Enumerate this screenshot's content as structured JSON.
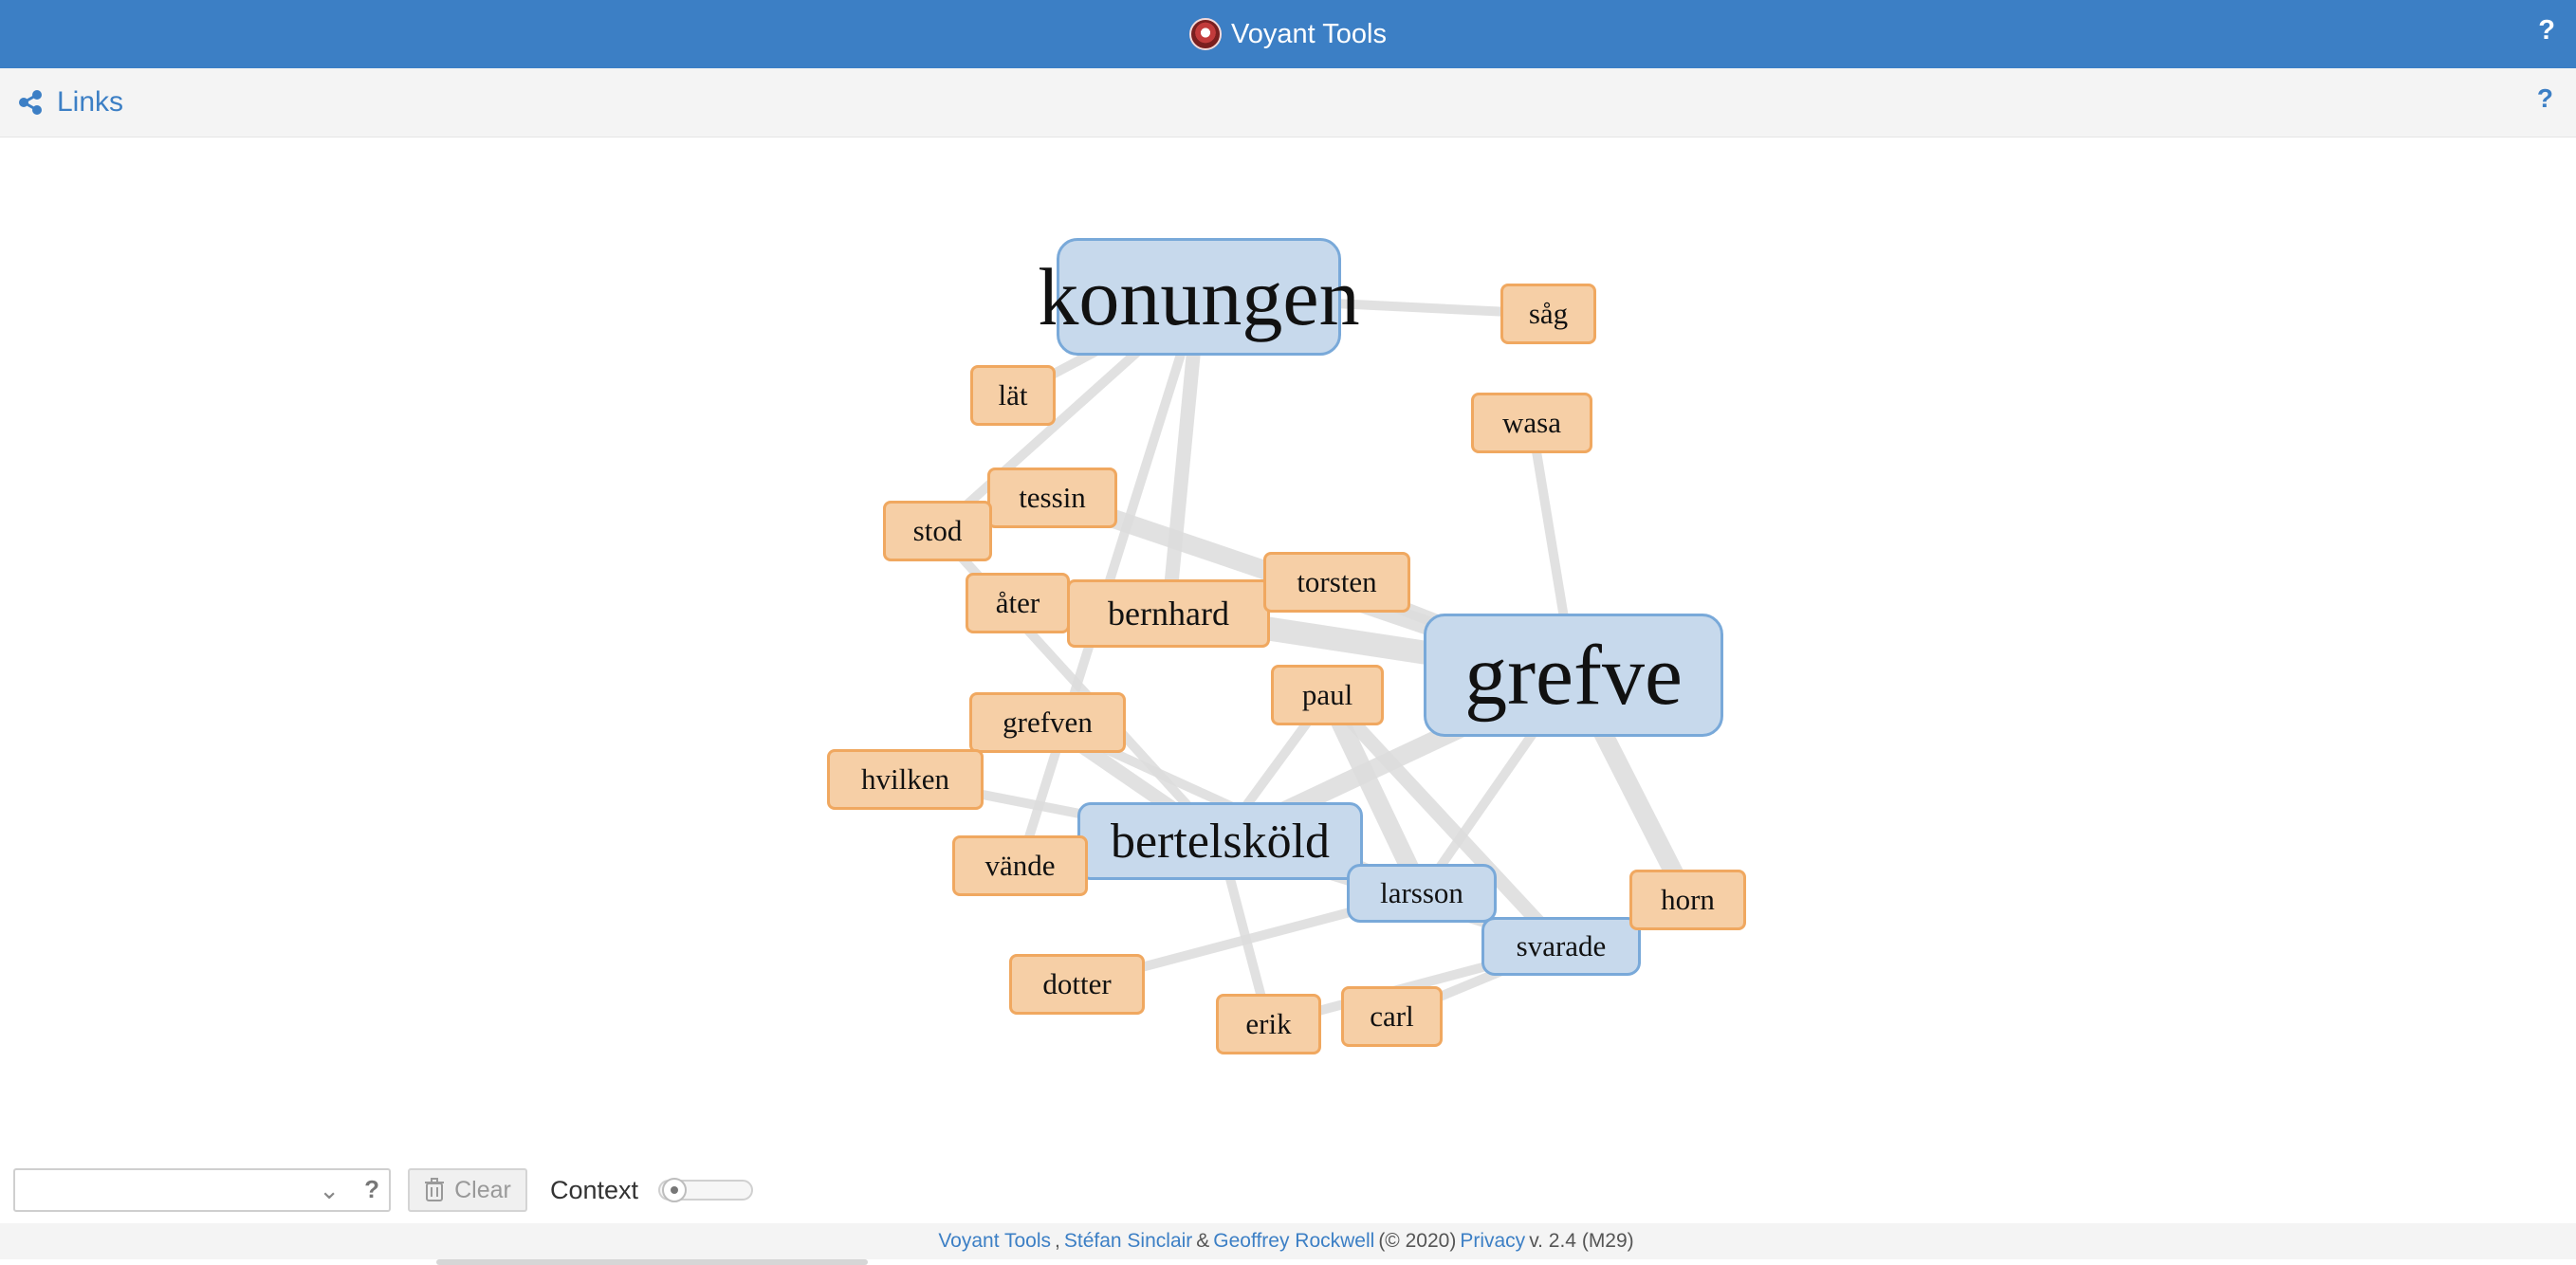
{
  "app": {
    "title": "Voyant Tools",
    "help_label": "?"
  },
  "panel": {
    "title": "Links",
    "help_label": "?"
  },
  "graph": {
    "nodes": [
      {
        "id": "konungen",
        "label": "konungen",
        "kind": "term",
        "weight": "large"
      },
      {
        "id": "grefve",
        "label": "grefve",
        "kind": "term",
        "weight": "large"
      },
      {
        "id": "bertelskold",
        "label": "bertelsköld",
        "kind": "term",
        "weight": "medium"
      },
      {
        "id": "larsson",
        "label": "larsson",
        "kind": "term",
        "weight": "small"
      },
      {
        "id": "svarade",
        "label": "svarade",
        "kind": "term",
        "weight": "small"
      },
      {
        "id": "sag",
        "label": "såg",
        "kind": "context"
      },
      {
        "id": "lat",
        "label": "lät",
        "kind": "context"
      },
      {
        "id": "wasa",
        "label": "wasa",
        "kind": "context"
      },
      {
        "id": "tessin",
        "label": "tessin",
        "kind": "context"
      },
      {
        "id": "stod",
        "label": "stod",
        "kind": "context"
      },
      {
        "id": "ater",
        "label": "åter",
        "kind": "context"
      },
      {
        "id": "bernhard",
        "label": "bernhard",
        "kind": "context"
      },
      {
        "id": "torsten",
        "label": "torsten",
        "kind": "context"
      },
      {
        "id": "paul",
        "label": "paul",
        "kind": "context"
      },
      {
        "id": "grefven",
        "label": "grefven",
        "kind": "context"
      },
      {
        "id": "hvilken",
        "label": "hvilken",
        "kind": "context"
      },
      {
        "id": "vande",
        "label": "vände",
        "kind": "context"
      },
      {
        "id": "horn",
        "label": "horn",
        "kind": "context"
      },
      {
        "id": "dotter",
        "label": "dotter",
        "kind": "context"
      },
      {
        "id": "erik",
        "label": "erik",
        "kind": "context"
      },
      {
        "id": "carl",
        "label": "carl",
        "kind": "context"
      }
    ],
    "links": [
      {
        "source": "konungen",
        "target": "sag",
        "strength": 1
      },
      {
        "source": "konungen",
        "target": "lat",
        "strength": 1
      },
      {
        "source": "konungen",
        "target": "stod",
        "strength": 1
      },
      {
        "source": "konungen",
        "target": "bernhard",
        "strength": 2
      },
      {
        "source": "konungen",
        "target": "vande",
        "strength": 1
      },
      {
        "source": "grefve",
        "target": "wasa",
        "strength": 1
      },
      {
        "source": "grefve",
        "target": "tessin",
        "strength": 3
      },
      {
        "source": "grefve",
        "target": "bernhard",
        "strength": 4
      },
      {
        "source": "grefve",
        "target": "torsten",
        "strength": 2
      },
      {
        "source": "grefve",
        "target": "bertelskold",
        "strength": 3
      },
      {
        "source": "grefve",
        "target": "larsson",
        "strength": 1
      },
      {
        "source": "grefve",
        "target": "horn",
        "strength": 3
      },
      {
        "source": "bertelskold",
        "target": "stod",
        "strength": 1
      },
      {
        "source": "bertelskold",
        "target": "grefven",
        "strength": 2
      },
      {
        "source": "bertelskold",
        "target": "hvilken",
        "strength": 1
      },
      {
        "source": "bertelskold",
        "target": "vande",
        "strength": 1
      },
      {
        "source": "bertelskold",
        "target": "paul",
        "strength": 1
      },
      {
        "source": "bertelskold",
        "target": "erik",
        "strength": 1
      },
      {
        "source": "larsson",
        "target": "paul",
        "strength": 3
      },
      {
        "source": "larsson",
        "target": "dotter",
        "strength": 1
      },
      {
        "source": "larsson",
        "target": "grefven",
        "strength": 1
      },
      {
        "source": "svarade",
        "target": "carl",
        "strength": 1
      },
      {
        "source": "svarade",
        "target": "erik",
        "strength": 1
      },
      {
        "source": "svarade",
        "target": "paul",
        "strength": 2
      },
      {
        "source": "svarade",
        "target": "bertelskold",
        "strength": 1
      }
    ]
  },
  "toolbar": {
    "search_value": "",
    "search_help": "?",
    "clear_label": "Clear",
    "context_label": "Context",
    "context_value": 0
  },
  "footer": {
    "voyant_link": "Voyant Tools",
    "sep_comma": ",",
    "author1": "Stéfan Sinclair",
    "amp": "&",
    "author2": "Geoffrey Rockwell",
    "copyright": "(© 2020)",
    "privacy": "Privacy",
    "version": "v. 2.4 (M29)"
  },
  "colors": {
    "header": "#3c7fc5",
    "term_fill": "#c7d9ec",
    "term_border": "#79a9d9",
    "context_fill": "#f6cfa6",
    "context_border": "#f0a860",
    "link": "#dcdcdc"
  }
}
